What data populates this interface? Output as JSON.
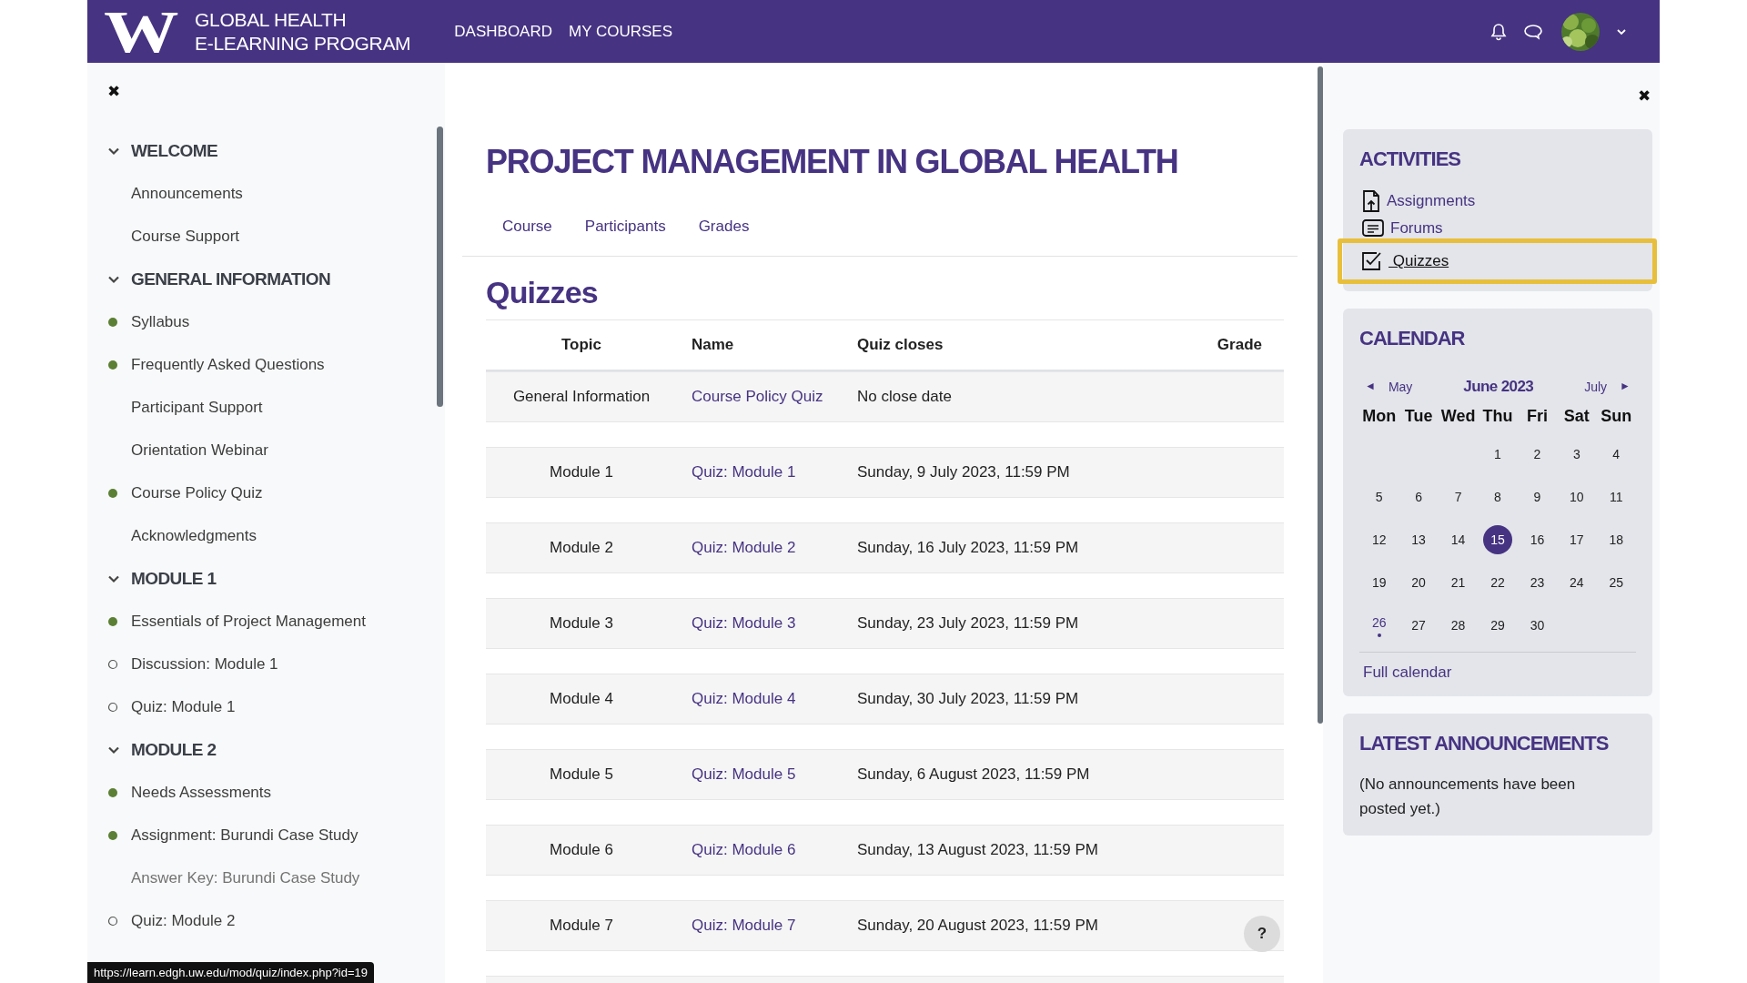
{
  "header": {
    "logo_letter": "W",
    "logo_lines": [
      "GLOBAL HEALTH",
      "E-LEARNING PROGRAM"
    ],
    "nav": [
      "DASHBOARD",
      "MY COURSES"
    ]
  },
  "sidebar": {
    "close": "✖",
    "sections": [
      {
        "title": "WELCOME",
        "expanded": true,
        "items": [
          {
            "label": "Announcements",
            "kind": "none",
            "dimmed": false
          },
          {
            "label": "Course Support",
            "kind": "none",
            "dimmed": false
          }
        ]
      },
      {
        "title": "GENERAL INFORMATION",
        "expanded": true,
        "items": [
          {
            "label": "Syllabus",
            "kind": "done",
            "dimmed": false
          },
          {
            "label": "Frequently Asked Questions",
            "kind": "done",
            "dimmed": false
          },
          {
            "label": "Participant Support",
            "kind": "none",
            "dimmed": false
          },
          {
            "label": "Orientation Webinar",
            "kind": "none",
            "dimmed": false
          },
          {
            "label": "Course Policy Quiz",
            "kind": "done",
            "dimmed": false
          },
          {
            "label": "Acknowledgments",
            "kind": "none",
            "dimmed": false
          }
        ]
      },
      {
        "title": "MODULE 1",
        "expanded": true,
        "items": [
          {
            "label": "Essentials of Project Management",
            "kind": "done",
            "dimmed": false
          },
          {
            "label": "Discussion: Module 1",
            "kind": "todo",
            "dimmed": false
          },
          {
            "label": "Quiz: Module 1",
            "kind": "todo",
            "dimmed": false
          }
        ]
      },
      {
        "title": "MODULE 2",
        "expanded": true,
        "items": [
          {
            "label": "Needs Assessments",
            "kind": "done",
            "dimmed": false
          },
          {
            "label": "Assignment: Burundi Case Study",
            "kind": "done",
            "dimmed": false
          },
          {
            "label": "Answer Key: Burundi Case Study",
            "kind": "none",
            "dimmed": true
          },
          {
            "label": "Quiz: Module 2",
            "kind": "todo",
            "dimmed": false
          }
        ]
      }
    ]
  },
  "status_url": "https://learn.edgh.uw.edu/mod/quiz/index.php?id=19",
  "main": {
    "title": "PROJECT MANAGEMENT IN GLOBAL HEALTH",
    "tabs": [
      {
        "label": "Course",
        "selected": false
      },
      {
        "label": "Participants",
        "selected": false
      },
      {
        "label": "Grades",
        "selected": false
      }
    ],
    "heading": "Quizzes",
    "columns": [
      "Topic",
      "Name",
      "Quiz closes",
      "Grade"
    ],
    "rows": [
      {
        "topic": "General Information",
        "name": "Course Policy Quiz",
        "closes": "No close date"
      },
      {
        "topic": "Module 1",
        "name": "Quiz: Module 1",
        "closes": "Sunday, 9 July 2023, 11:59 PM"
      },
      {
        "topic": "Module 2",
        "name": "Quiz: Module 2",
        "closes": "Sunday, 16 July 2023, 11:59 PM"
      },
      {
        "topic": "Module 3",
        "name": "Quiz: Module 3",
        "closes": "Sunday, 23 July 2023, 11:59 PM"
      },
      {
        "topic": "Module 4",
        "name": "Quiz: Module 4",
        "closes": "Sunday, 30 July 2023, 11:59 PM"
      },
      {
        "topic": "Module 5",
        "name": "Quiz: Module 5",
        "closes": "Sunday, 6 August 2023, 11:59 PM"
      },
      {
        "topic": "Module 6",
        "name": "Quiz: Module 6",
        "closes": "Sunday, 13 August 2023, 11:59 PM"
      },
      {
        "topic": "Module 7",
        "name": "Quiz: Module 7",
        "closes": "Sunday, 20 August 2023, 11:59 PM"
      }
    ],
    "help": "?"
  },
  "right": {
    "close": "✖",
    "activities": {
      "title": "ACTIVITIES",
      "items": [
        {
          "label": "Assignments",
          "kind": "assignment",
          "highlighted": false
        },
        {
          "label": "Forums",
          "kind": "forum",
          "highlighted": false
        },
        {
          "label": " Quizzes",
          "kind": "quiz",
          "highlighted": true
        }
      ]
    },
    "calendar": {
      "title": "CALENDAR",
      "prev": "May",
      "month": "June 2023",
      "next": "July",
      "prev_arrow": "◄",
      "next_arrow": "►",
      "weekdays": [
        "Mon",
        "Tue",
        "Wed",
        "Thu",
        "Fri",
        "Sat",
        "Sun"
      ],
      "weeks": [
        [
          {
            "day": "1",
            "today": false,
            "event": false
          },
          {
            "day": "2",
            "today": false,
            "event": false
          },
          {
            "day": "3",
            "today": false,
            "event": false
          },
          {
            "day": "4",
            "today": false,
            "event": false
          }
        ],
        [
          {
            "day": "5",
            "today": false,
            "event": false
          },
          {
            "day": "6",
            "today": false,
            "event": false
          },
          {
            "day": "7",
            "today": false,
            "event": false
          },
          {
            "day": "8",
            "today": false,
            "event": false
          },
          {
            "day": "9",
            "today": false,
            "event": false
          },
          {
            "day": "10",
            "today": false,
            "event": false
          },
          {
            "day": "11",
            "today": false,
            "event": false
          }
        ],
        [
          {
            "day": "12",
            "today": false,
            "event": false
          },
          {
            "day": "13",
            "today": false,
            "event": false
          },
          {
            "day": "14",
            "today": false,
            "event": false
          },
          {
            "day": "15",
            "today": true,
            "event": false
          },
          {
            "day": "16",
            "today": false,
            "event": false
          },
          {
            "day": "17",
            "today": false,
            "event": false
          },
          {
            "day": "18",
            "today": false,
            "event": false
          }
        ],
        [
          {
            "day": "19",
            "today": false,
            "event": false
          },
          {
            "day": "20",
            "today": false,
            "event": false
          },
          {
            "day": "21",
            "today": false,
            "event": false
          },
          {
            "day": "22",
            "today": false,
            "event": false
          },
          {
            "day": "23",
            "today": false,
            "event": false
          },
          {
            "day": "24",
            "today": false,
            "event": false
          },
          {
            "day": "25",
            "today": false,
            "event": false
          }
        ],
        [
          {
            "day": "26",
            "today": false,
            "event": true
          },
          {
            "day": "27",
            "today": false,
            "event": false
          },
          {
            "day": "28",
            "today": false,
            "event": false
          },
          {
            "day": "29",
            "today": false,
            "event": false
          },
          {
            "day": "30",
            "today": false,
            "event": false
          }
        ]
      ],
      "full_link": "Full calendar"
    },
    "announcements": {
      "title": "LATEST ANNOUNCEMENTS",
      "text": "(No announcements have been posted yet.)"
    }
  }
}
